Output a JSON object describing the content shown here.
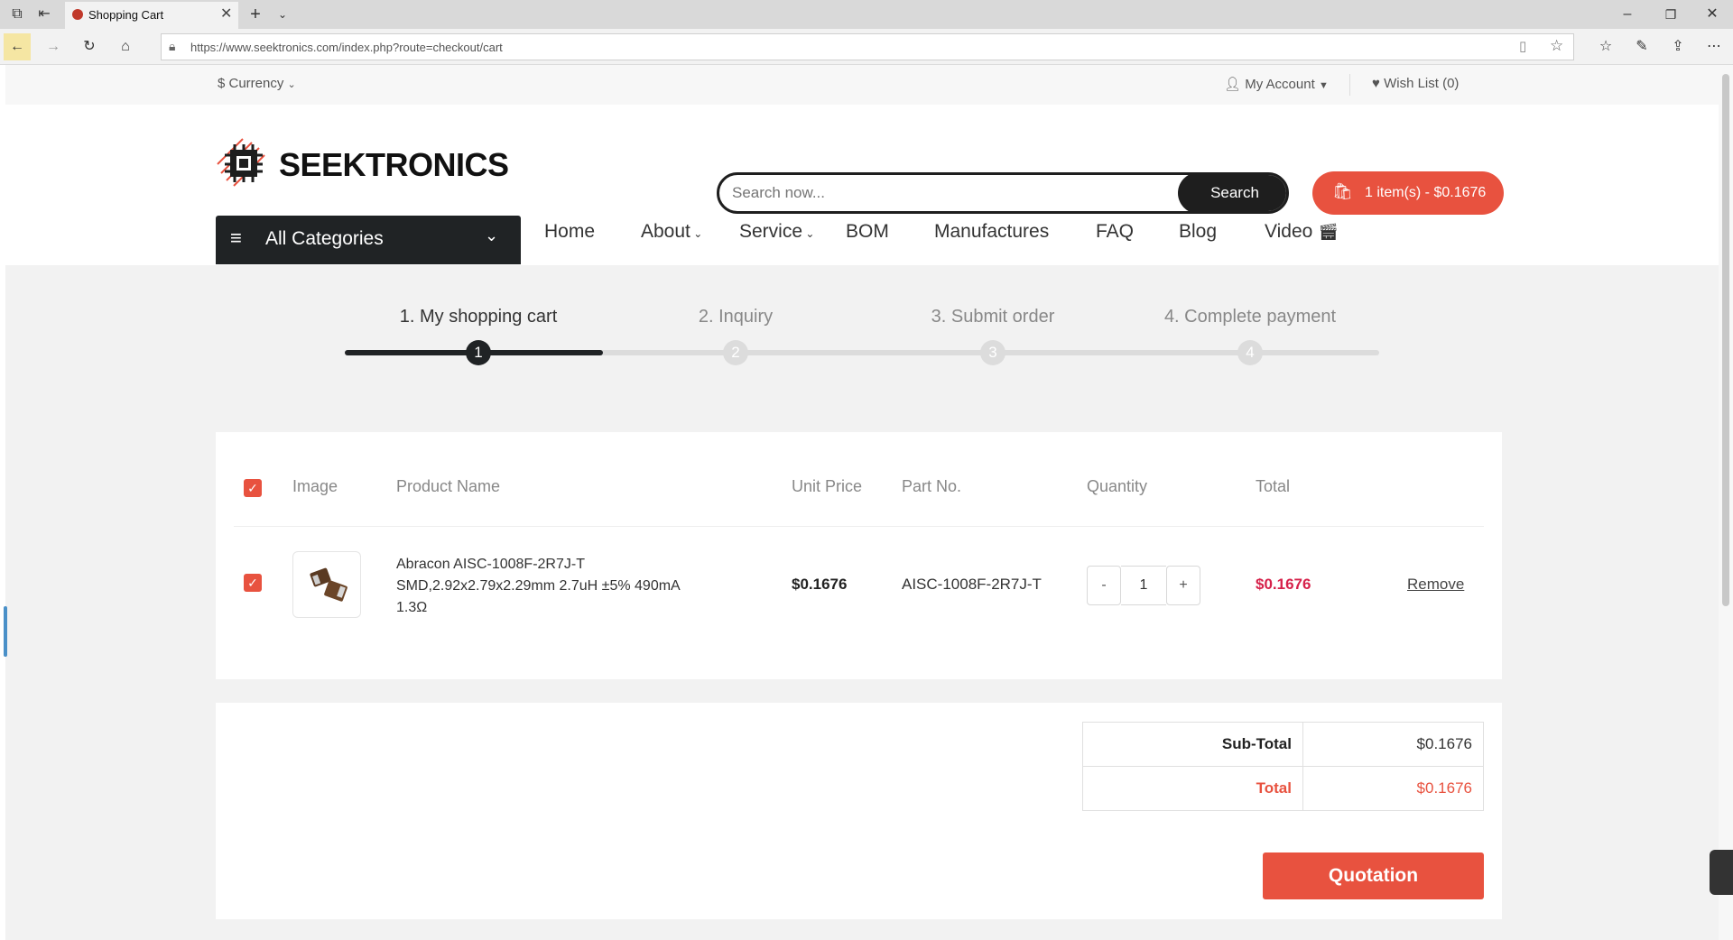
{
  "browser": {
    "tab_title": "Shopping Cart",
    "url": "https://www.seektronics.com/index.php?route=checkout/cart"
  },
  "topbar": {
    "currency": "$ Currency",
    "my_account": "My Account",
    "wish_list": "Wish List (0)"
  },
  "header": {
    "logo_text": "SEEKTRONICS",
    "search_placeholder": "Search now...",
    "search_button": "Search",
    "cart_summary": "1 item(s) - $0.1676"
  },
  "nav": {
    "all_categories": "All Categories",
    "items": [
      "Home",
      "About",
      "Service",
      "BOM",
      "Manufactures",
      "FAQ",
      "Blog",
      "Video"
    ]
  },
  "steps": [
    {
      "label": "1. My shopping cart",
      "num": "1"
    },
    {
      "label": "2. Inquiry",
      "num": "2"
    },
    {
      "label": "3. Submit order",
      "num": "3"
    },
    {
      "label": "4. Complete payment",
      "num": "4"
    }
  ],
  "cart": {
    "headers": {
      "image": "Image",
      "product_name": "Product Name",
      "unit_price": "Unit Price",
      "part_no": "Part No.",
      "quantity": "Quantity",
      "total": "Total"
    },
    "row": {
      "name_line1": "Abracon AISC-1008F-2R7J-T",
      "name_line2": "SMD,2.92x2.79x2.29mm 2.7uH ±5% 490mA",
      "name_line3": "1.3Ω",
      "unit_price": "$0.1676",
      "part_no": "AISC-1008F-2R7J-T",
      "qty": "1",
      "qty_minus": "-",
      "qty_plus": "+",
      "total": "$0.1676",
      "remove": "Remove"
    }
  },
  "totals": {
    "subtotal_label": "Sub-Total",
    "subtotal_value": "$0.1676",
    "total_label": "Total",
    "total_value": "$0.1676",
    "quotation_button": "Quotation"
  },
  "colors": {
    "accent": "#e8523f",
    "dark": "#202325",
    "price_red": "#d6214a"
  }
}
